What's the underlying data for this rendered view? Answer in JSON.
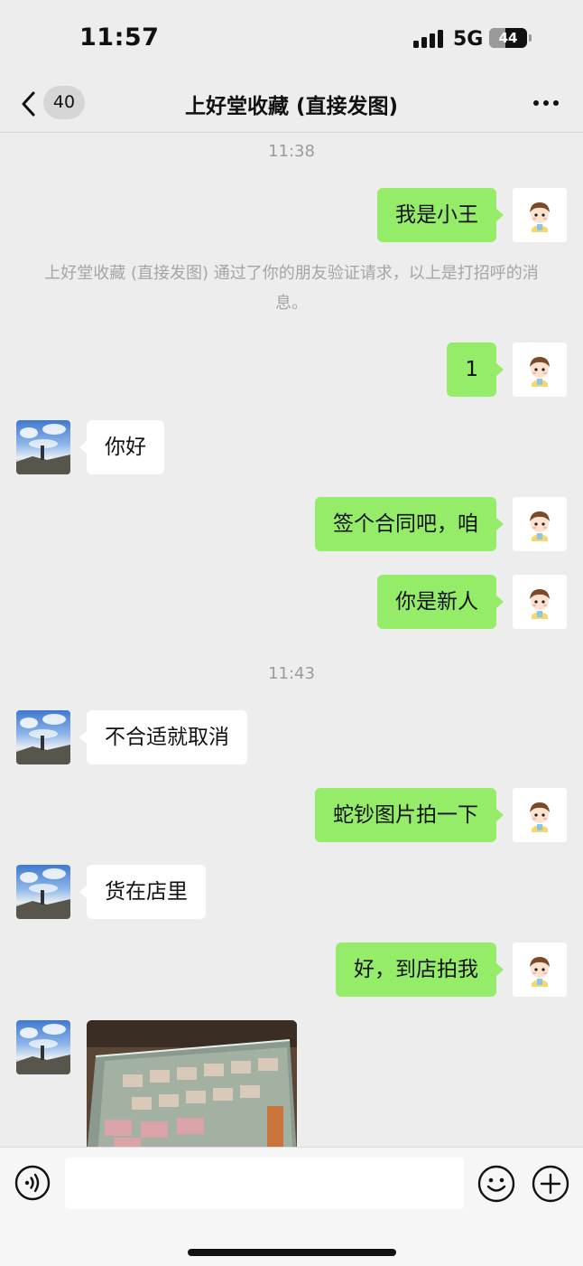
{
  "status_bar": {
    "time": "11:57",
    "network": "5G",
    "battery": "44",
    "battery_level": 0.44
  },
  "nav": {
    "unread_count": "40",
    "title": "上好堂收藏 (直接发图)"
  },
  "chat": {
    "timestamp_1": "11:38",
    "msg_1": "我是小王",
    "system_notice": "上好堂收藏 (直接发图) 通过了你的朋友验证请求，以上是打招呼的消息。",
    "msg_2": "1",
    "msg_3": "你好",
    "msg_4": "签个合同吧，咱",
    "msg_5": "你是新人",
    "timestamp_2": "11:43",
    "msg_6": "不合适就取消",
    "msg_7": "蛇钞图片拍一下",
    "msg_8": "货在店里",
    "msg_9": "好，到店拍我"
  },
  "colors": {
    "sent_bubble": "#95ec69",
    "received_bubble": "#ffffff",
    "background": "#ededed"
  }
}
